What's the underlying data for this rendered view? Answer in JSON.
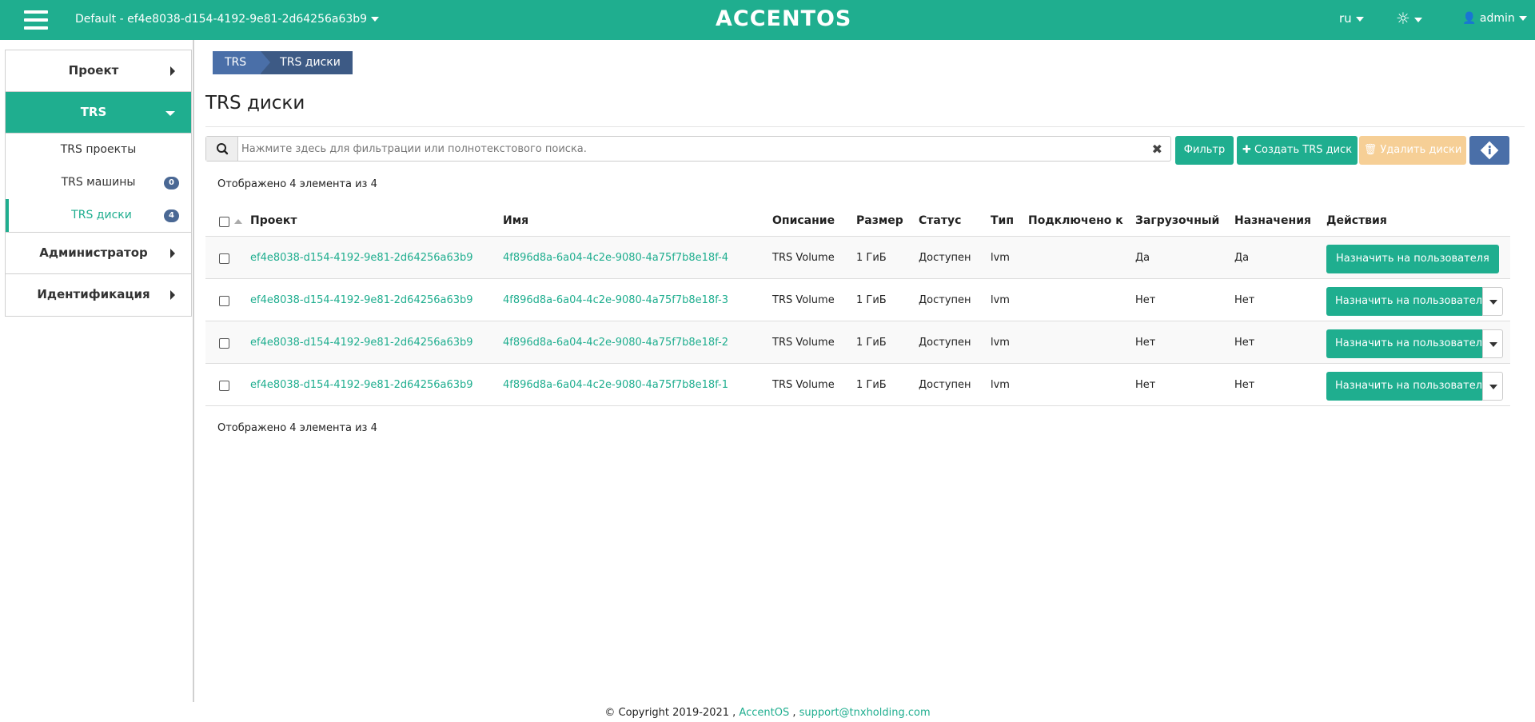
{
  "header": {
    "project": "Default - ef4e8038-d154-4192-9e81-2d64256a63b9",
    "logo": "ACCENTOS",
    "lang": "ru",
    "user": "admin",
    "colors": {
      "accent": "#1fae8f",
      "nav": "#4a6fa8",
      "warning": "#f6cf96"
    }
  },
  "sidebar": {
    "sections": [
      {
        "label": "Проект"
      },
      {
        "label": "TRS"
      },
      {
        "label": "Администратор"
      },
      {
        "label": "Идентификация"
      }
    ],
    "items": [
      {
        "label": "TRS проекты"
      },
      {
        "label": "TRS машины",
        "badge": "0"
      },
      {
        "label": "TRS диски",
        "badge": "4"
      }
    ]
  },
  "breadcrumb": [
    "TRS",
    "TRS диски"
  ],
  "page_title": "TRS диски",
  "search": {
    "placeholder": "Нажмите здесь для фильтрации или полнотекстового поиска."
  },
  "toolbar": {
    "filter": "Фильтр",
    "create": "Создать TRS диск",
    "delete": "Удалить диски"
  },
  "count_text": "Отображено 4 элемента из 4",
  "table": {
    "headers": [
      "Проект",
      "Имя",
      "Описание",
      "Размер",
      "Статус",
      "Тип",
      "Подключено к",
      "Загрузочный",
      "Назначения",
      "Действия"
    ],
    "rows": [
      {
        "project": "ef4e8038-d154-4192-9e81-2d64256a63b9",
        "name": "4f896d8a-6a04-4c2e-9080-4a75f7b8e18f-4",
        "description": "TRS Volume",
        "size": "1 ГиБ",
        "status": "Доступен",
        "type": "lvm",
        "attached": "",
        "bootable": "Да",
        "assigned": "Да",
        "action": "Назначить на пользователя"
      },
      {
        "project": "ef4e8038-d154-4192-9e81-2d64256a63b9",
        "name": "4f896d8a-6a04-4c2e-9080-4a75f7b8e18f-3",
        "description": "TRS Volume",
        "size": "1 ГиБ",
        "status": "Доступен",
        "type": "lvm",
        "attached": "",
        "bootable": "Нет",
        "assigned": "Нет",
        "action": "Назначить на пользователя"
      },
      {
        "project": "ef4e8038-d154-4192-9e81-2d64256a63b9",
        "name": "4f896d8a-6a04-4c2e-9080-4a75f7b8e18f-2",
        "description": "TRS Volume",
        "size": "1 ГиБ",
        "status": "Доступен",
        "type": "lvm",
        "attached": "",
        "bootable": "Нет",
        "assigned": "Нет",
        "action": "Назначить на пользователя"
      },
      {
        "project": "ef4e8038-d154-4192-9e81-2d64256a63b9",
        "name": "4f896d8a-6a04-4c2e-9080-4a75f7b8e18f-1",
        "description": "TRS Volume",
        "size": "1 ГиБ",
        "status": "Доступен",
        "type": "lvm",
        "attached": "",
        "bootable": "Нет",
        "assigned": "Нет",
        "action": "Назначить на пользователя"
      }
    ]
  },
  "footer": {
    "copyright": "© Copyright 2019-2021 ,",
    "brand": "AccentOS",
    "sep": ",",
    "email": "support@tnxholding.com"
  }
}
